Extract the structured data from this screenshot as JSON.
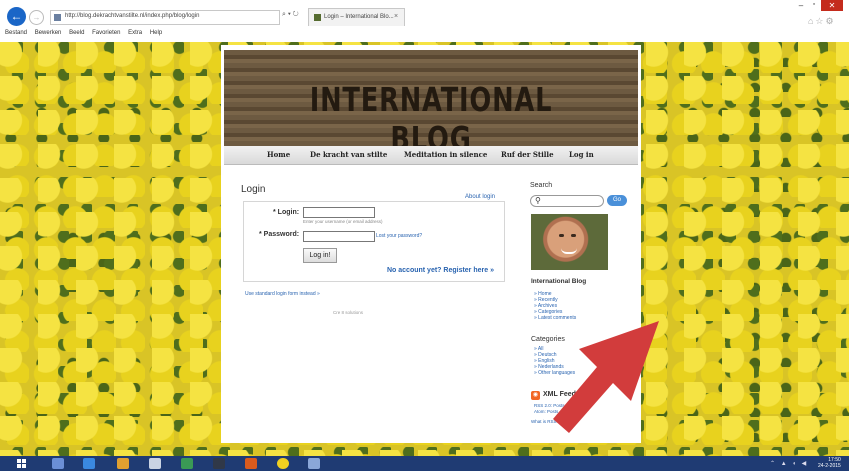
{
  "browser": {
    "address": "http://blog.dekrachtvanstilte.nl/index.php/blog/login",
    "address_buttons": "⌕ ▾ ↻",
    "tab_title": "Login – International Blo...",
    "tab_close": "×",
    "back": "←",
    "forward": "→",
    "menu": [
      "Bestand",
      "Bewerken",
      "Beeld",
      "Favorieten",
      "Extra",
      "Help"
    ],
    "window_min": "–",
    "window_max": "▫",
    "window_close": "✕",
    "toolbar_icons": "⌂☆⚙"
  },
  "site": {
    "banner_title": "INTERNATIONAL BLOG",
    "nav": [
      "Home",
      "De kracht van stilte",
      "Meditation in silence",
      "Ruf der Stille",
      "Log in"
    ]
  },
  "login": {
    "title": "Login",
    "about_login": "About login",
    "login_label": "* Login:",
    "login_hint": "Enter your username (or email address)",
    "password_label": "* Password:",
    "lost_password": "Lost your password?",
    "button": "Log in!",
    "register": "No account yet? Register here »",
    "standard_form": "Use standard login form instead »",
    "footer": "Cre 8 solutions"
  },
  "sidebar": {
    "search_title": "Search",
    "search_icon": "search-icon",
    "go_button": "Go",
    "blog_heading": "International Blog",
    "blog_links": [
      "Home",
      "Recently",
      "Archives",
      "Categories",
      "Latest comments"
    ],
    "cat_heading": "Categories",
    "cat_links": [
      "All",
      "Deutsch",
      "English",
      "Nederlands",
      "Other languages"
    ],
    "xml_heading": "XML Feeds",
    "xml_line1": "RSS 2.0: Posts, Comments",
    "xml_line2": "Atom: Posts, Comments",
    "more_rss": "What is RSS?"
  },
  "taskbar": {
    "time": "17:50",
    "date": "24-2-2015",
    "tray": "⌃ ▲ ◖ ◀"
  },
  "colors": {
    "link": "#2a64b0",
    "arrow": "#d23c3c",
    "taskbar": "#1f3b73",
    "go_button": "#4a90d9"
  }
}
